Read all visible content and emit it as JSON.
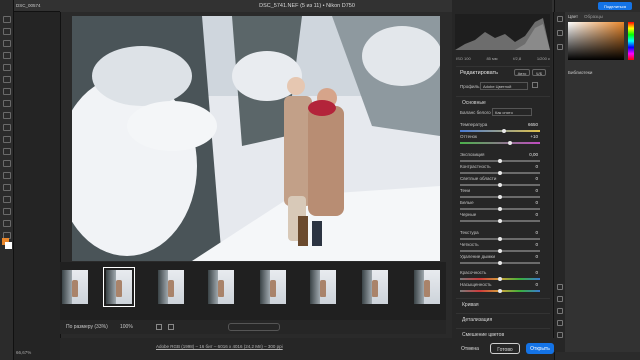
{
  "document_tab": "DSC_00574",
  "window_title": "DSC_5741.NEF (5 из 11) • Nikon D750",
  "share_button": "Поделиться",
  "hist_info": [
    "ISO 100",
    "85 мм",
    "f/2,8",
    "1/200 с"
  ],
  "edit_title": "Редактировать",
  "auto_btn": "Авто",
  "bw_btn": "Ч/Б",
  "profile_label": "Профиль",
  "profile_value": "Adobe Цветной",
  "basic_section": "Основные",
  "wb_label": "Баланс белого",
  "wb_value": "Как снято",
  "sliders": [
    {
      "label": "Температура",
      "value": "6650"
    },
    {
      "label": "Оттенок",
      "value": "+10"
    },
    {
      "label": "Экспозиция",
      "value": "0,00"
    },
    {
      "label": "Контрастность",
      "value": "0"
    },
    {
      "label": "Светлые области",
      "value": "0"
    },
    {
      "label": "Тени",
      "value": "0"
    },
    {
      "label": "Белые",
      "value": "0"
    },
    {
      "label": "Черные",
      "value": "0"
    },
    {
      "label": "Текстура",
      "value": "0"
    },
    {
      "label": "Четкость",
      "value": "0"
    },
    {
      "label": "Удаление дымки",
      "value": "0"
    },
    {
      "label": "Красочность",
      "value": "0"
    },
    {
      "label": "Насыщенность",
      "value": "0"
    }
  ],
  "slider_levels": [
    0.55,
    0.62,
    0.5,
    0.5,
    0.5,
    0.5,
    0.5,
    0.5,
    0.5,
    0.5,
    0.5,
    0.5,
    0.5
  ],
  "sections": [
    "Кривая",
    "Детализация",
    "Смешение цветов"
  ],
  "status": {
    "fit": "По размеру (33%)",
    "zoom": "100%"
  },
  "file_info": "Adobe RGB (1998) – 16 бит – 6016 x 4016 (24,2 Мп) – 300 ppi",
  "buttons": {
    "cancel": "Отмена",
    "done": "Готово",
    "open": "Открыть"
  },
  "right_tabs": [
    "Цвет",
    "Образцы"
  ],
  "right_labels": [
    "Библиотеки"
  ],
  "zoom_left": "66,67%",
  "colors": {
    "accent": "#1473e6",
    "brand_orange": "#e8862a"
  }
}
